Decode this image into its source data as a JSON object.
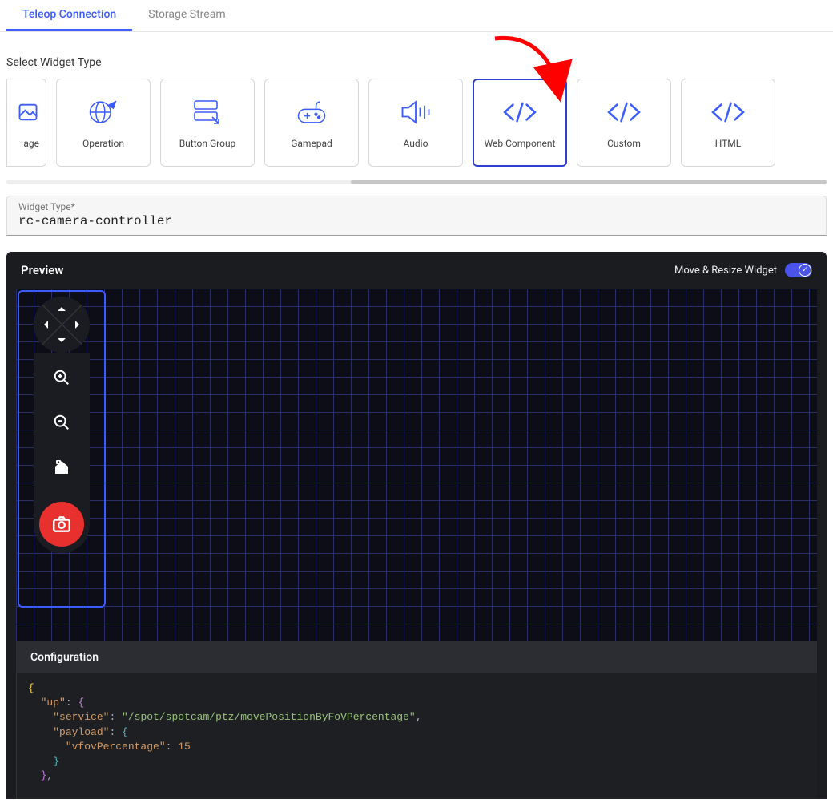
{
  "tabs": {
    "items": [
      {
        "label": "Teleop Connection",
        "active": true
      },
      {
        "label": "Storage Stream",
        "active": false
      }
    ]
  },
  "section_titles": {
    "select_widget": "Select Widget Type"
  },
  "widget_types": [
    {
      "id": "image-partial",
      "label": "age",
      "icon": "image-icon",
      "partial": true
    },
    {
      "id": "operation",
      "label": "Operation",
      "icon": "globe-arrow-icon"
    },
    {
      "id": "button-group",
      "label": "Button Group",
      "icon": "button-group-icon"
    },
    {
      "id": "gamepad",
      "label": "Gamepad",
      "icon": "gamepad-icon"
    },
    {
      "id": "audio",
      "label": "Audio",
      "icon": "audio-icon"
    },
    {
      "id": "web-component",
      "label": "Web Component",
      "icon": "code-icon",
      "selected": true
    },
    {
      "id": "custom",
      "label": "Custom",
      "icon": "code-icon"
    },
    {
      "id": "html",
      "label": "HTML",
      "icon": "code-icon"
    }
  ],
  "widget_type_field": {
    "label": "Widget Type*",
    "value": "rc-camera-controller"
  },
  "preview": {
    "title": "Preview",
    "toggle_label": "Move & Resize Widget",
    "toggle_on": true
  },
  "configuration": {
    "title": "Configuration",
    "code_tokens": [
      {
        "t": "brace",
        "v": "{"
      },
      {
        "t": "nl"
      },
      {
        "t": "indent",
        "n": 1
      },
      {
        "t": "key",
        "v": "\"up\""
      },
      {
        "t": "punct",
        "v": ": "
      },
      {
        "t": "brace2",
        "v": "{"
      },
      {
        "t": "nl"
      },
      {
        "t": "indent",
        "n": 2
      },
      {
        "t": "key",
        "v": "\"service\""
      },
      {
        "t": "punct",
        "v": ": "
      },
      {
        "t": "str",
        "v": "\"/spot/spotcam/ptz/movePositionByFoVPercentage\""
      },
      {
        "t": "punct",
        "v": ","
      },
      {
        "t": "nl"
      },
      {
        "t": "indent",
        "n": 2
      },
      {
        "t": "key",
        "v": "\"payload\""
      },
      {
        "t": "punct",
        "v": ": "
      },
      {
        "t": "brace3",
        "v": "{"
      },
      {
        "t": "nl"
      },
      {
        "t": "indent",
        "n": 3
      },
      {
        "t": "key",
        "v": "\"vfovPercentage\""
      },
      {
        "t": "punct",
        "v": ": "
      },
      {
        "t": "num",
        "v": "15"
      },
      {
        "t": "nl"
      },
      {
        "t": "indent",
        "n": 2
      },
      {
        "t": "brace3",
        "v": "}"
      },
      {
        "t": "nl"
      },
      {
        "t": "indent",
        "n": 1
      },
      {
        "t": "brace2",
        "v": "}"
      },
      {
        "t": "punct",
        "v": ","
      }
    ]
  },
  "colors": {
    "accent": "#3b5bfd",
    "danger": "#e8312f"
  }
}
